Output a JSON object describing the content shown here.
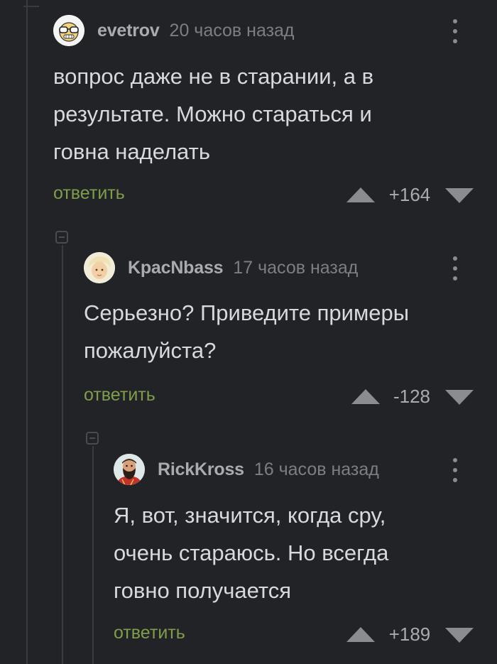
{
  "comments": [
    {
      "author": "evetrov",
      "time": "20 часов назад",
      "text": "вопрос даже не в старании, а в\nрезультате. Можно стараться и\nговна наделать",
      "reply_label": "ответить",
      "rating": "+164",
      "avatar": "glasses-face-avatar"
    },
    {
      "author": "KpacNbass",
      "time": "17 часов назад",
      "text": "Серьезно? Приведите примеры\nпожалуйста?",
      "reply_label": "ответить",
      "rating": "-128",
      "avatar": "blonde-avatar"
    },
    {
      "author": "RickKross",
      "time": "16 часов назад",
      "text": "Я, вот, значится, когда сру,\nочень стараюсь. Но всегда\nговно получается",
      "reply_label": "ответить",
      "rating": "+189",
      "avatar": "bearded-man-avatar"
    }
  ],
  "icons": {
    "upvote": "triangle-up-icon",
    "downvote": "triangle-down-icon",
    "more": "vertical-dots-icon",
    "collapse": "collapse-minus-icon"
  },
  "colors": {
    "background": "#222326",
    "reply": "#7f9d4b",
    "text": "#d8d9dc",
    "meta": "#7c7e83"
  }
}
